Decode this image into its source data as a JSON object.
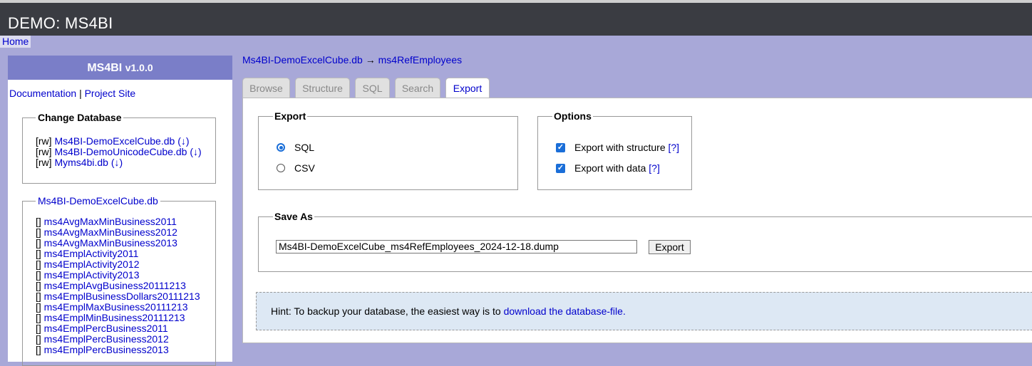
{
  "app": {
    "title": "DEMO: MS4BI",
    "home_link": "Home"
  },
  "sidebar": {
    "product": "MS4BI",
    "version": "v1.0.0",
    "links": {
      "documentation": "Documentation",
      "separator": "|",
      "project_site": "Project Site"
    },
    "change_database": {
      "legend": "Change Database",
      "items": [
        {
          "mode": "[rw]",
          "name": "Ms4BI-DemoExcelCube.db",
          "download": "(↓)"
        },
        {
          "mode": "[rw]",
          "name": "Ms4BI-DemoUnicodeCube.db",
          "download": "(↓)"
        },
        {
          "mode": "[rw]",
          "name": "Myms4bi.db",
          "download": "(↓)"
        }
      ]
    },
    "tables": {
      "legend": "Ms4BI-DemoExcelCube.db",
      "items": [
        "ms4AvgMaxMinBusiness2011",
        "ms4AvgMaxMinBusiness2012",
        "ms4AvgMaxMinBusiness2013",
        "ms4EmplActivity2011",
        "ms4EmplActivity2012",
        "ms4EmplActivity2013",
        "ms4EmplAvgBusiness20111213",
        "ms4EmplBusinessDollars20111213",
        "ms4EmplMaxBusiness20111213",
        "ms4EmplMinBusiness20111213",
        "ms4EmplPercBusiness2011",
        "ms4EmplPercBusiness2012",
        "ms4EmplPercBusiness2013"
      ],
      "prefix": "[]"
    }
  },
  "breadcrumb": {
    "database": "Ms4BI-DemoExcelCube.db",
    "arrow": "→",
    "table": "ms4RefEmployees"
  },
  "tabs": [
    "Browse",
    "Structure",
    "SQL",
    "Search",
    "Export"
  ],
  "active_tab": "Export",
  "export": {
    "legend": "Export",
    "formats": [
      {
        "label": "SQL",
        "selected": true
      },
      {
        "label": "CSV",
        "selected": false
      }
    ]
  },
  "options": {
    "legend": "Options",
    "items": [
      {
        "label": "Export with structure",
        "help": "[?]",
        "checked": true
      },
      {
        "label": "Export with data",
        "help": "[?]",
        "checked": true
      }
    ]
  },
  "save_as": {
    "legend": "Save As",
    "filename": "Ms4BI-DemoExcelCube_ms4RefEmployees_2024-12-18.dump",
    "button": "Export"
  },
  "hint": {
    "text": "Hint: To backup your database, the easiest way is to ",
    "link": "download the database-file."
  }
}
